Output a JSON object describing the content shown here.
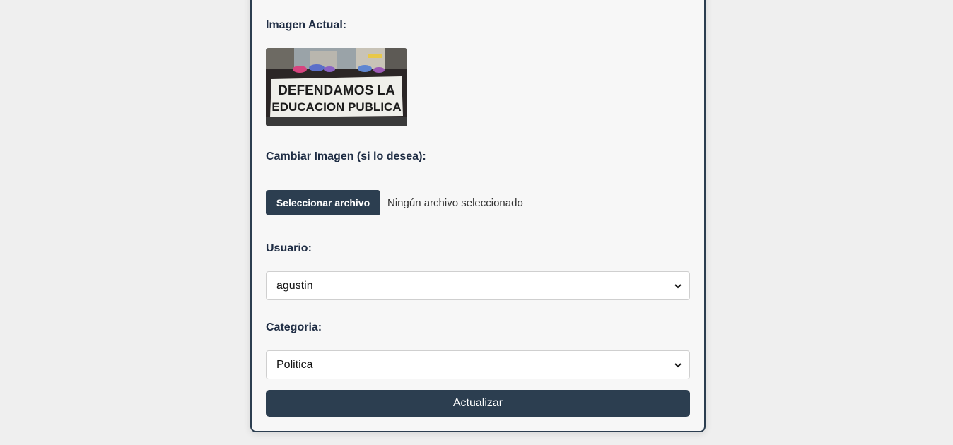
{
  "form": {
    "current_image_label": "Imagen Actual:",
    "current_image": {
      "alt_icon": "protest-photo",
      "banner_text_line1": "DEFENDAMOS LA",
      "banner_text_line2": "EDUCACION PUBLICA"
    },
    "change_image_label": "Cambiar Imagen (si lo desea):",
    "file_button_label": "Seleccionar archivo",
    "file_status": "Ningún archivo seleccionado",
    "user_label": "Usuario:",
    "user_value": "agustin",
    "category_label": "Categoria:",
    "category_value": "Politica",
    "submit_label": "Actualizar"
  },
  "colors": {
    "accent": "#2c3e50",
    "label": "#1f2d44",
    "page_bg": "#efefef",
    "card_bg": "#f7f7f7"
  }
}
